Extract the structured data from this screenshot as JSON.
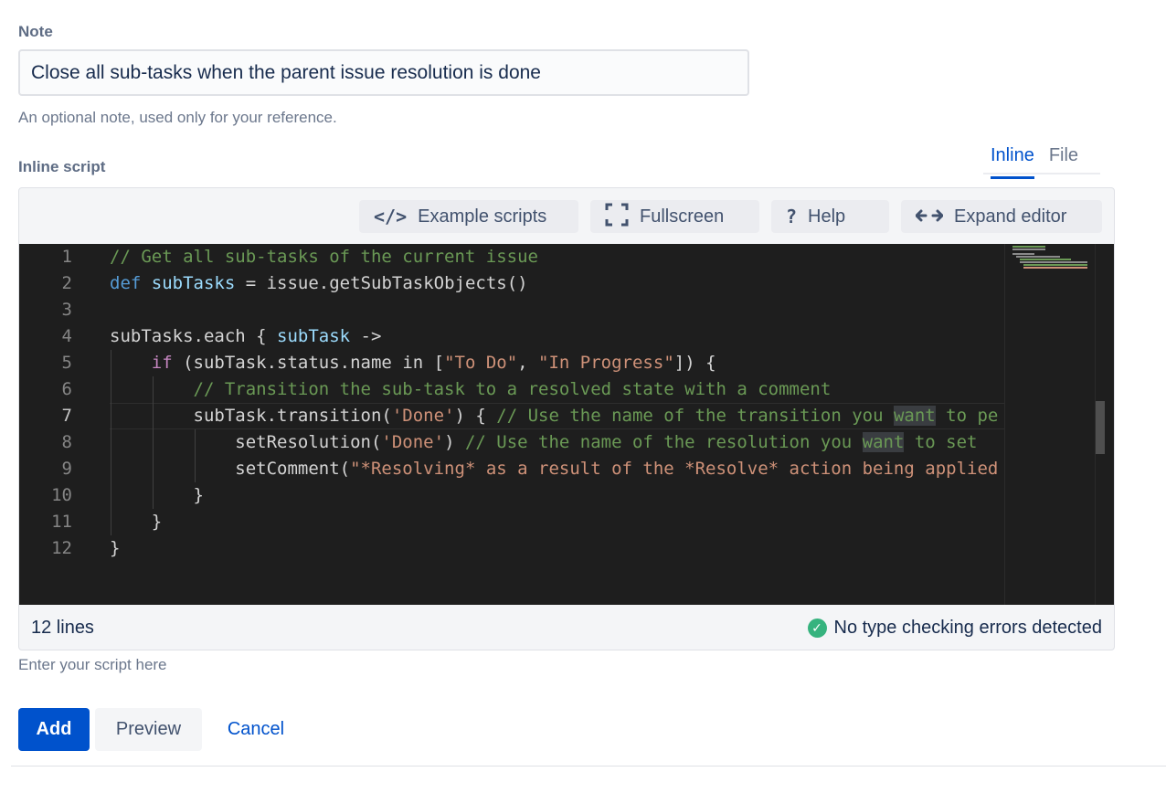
{
  "note": {
    "label": "Note",
    "value": "Close all sub-tasks when the parent issue resolution is done",
    "help": "An optional note, used only for your reference."
  },
  "script": {
    "label": "Inline script",
    "help": "Enter your script here"
  },
  "tabs": [
    {
      "label": "Inline",
      "active": true
    },
    {
      "label": "File",
      "active": false
    }
  ],
  "toolbar": {
    "example_scripts": "Example scripts",
    "fullscreen": "Fullscreen",
    "help": "Help",
    "expand_editor": "Expand editor",
    "icons": [
      "code-icon",
      "fullscreen-icon",
      "question-icon",
      "expand-arrows-icon"
    ]
  },
  "code": {
    "line_numbers": [
      "1",
      "2",
      "3",
      "4",
      "5",
      "6",
      "7",
      "8",
      "9",
      "10",
      "11",
      "12"
    ],
    "current_line": "7",
    "lines": [
      "// Get all sub-tasks of the current issue",
      "def subTasks = issue.getSubTaskObjects()",
      "",
      "subTasks.each { subTask ->",
      "    if (subTask.status.name in [\"To Do\", \"In Progress\"]) {",
      "        // Transition the sub-task to a resolved state with a comment",
      "        subTask.transition('Done') { // Use the name of the transition you want to pe",
      "            setResolution('Done') // Use the name of the resolution you want to set",
      "            setComment(\"*Resolving* as a result of the *Resolve* action being applied",
      "        }",
      "    }",
      "}"
    ]
  },
  "status": {
    "line_count": "12 lines",
    "type_check": "No type checking errors detected"
  },
  "actions": {
    "add": "Add",
    "preview": "Preview",
    "cancel": "Cancel"
  },
  "colors": {
    "primary": "#0052cc",
    "editor_bg": "#1e1e1e",
    "success": "#36b37e"
  }
}
